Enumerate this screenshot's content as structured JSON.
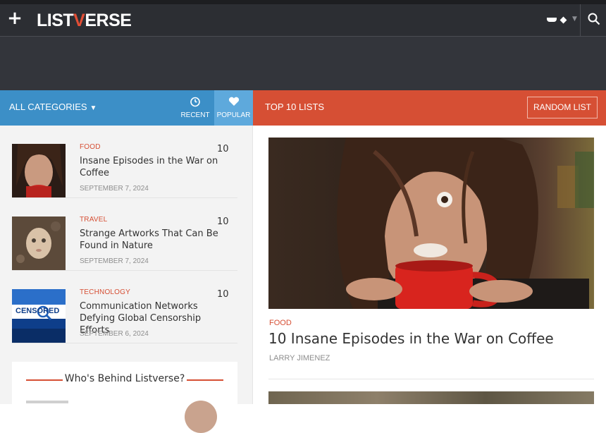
{
  "header": {
    "logo_left": "LIST",
    "logo_v": "V",
    "logo_right": "ERSE",
    "plus_icon": "plus-icon",
    "search_icon": "search-icon"
  },
  "category_bar": {
    "all_categories_label": "ALL CATEGORIES",
    "recent_label": "RECENT",
    "popular_label": "POPULAR"
  },
  "top_bar": {
    "title": "TOP 10 LISTS",
    "random_label": "RANDOM LIST"
  },
  "sidebar": {
    "items": [
      {
        "category": "FOOD",
        "title": "Insane Episodes in the War on Coffee",
        "date": "SEPTEMBER 7, 2024",
        "number": "10"
      },
      {
        "category": "TRAVEL",
        "title": "Strange Artworks That Can Be Found in Nature",
        "date": "SEPTEMBER 7, 2024",
        "number": "10"
      },
      {
        "category": "TECHNOLOGY",
        "title": "Communication Networks Defying Global Censorship Efforts",
        "date": "SEPTEMBER 6, 2024",
        "number": "10"
      }
    ],
    "censored_text": "CENSORED",
    "who_title": "Who's Behind Listverse?"
  },
  "featured": {
    "category": "FOOD",
    "title": "10 Insane Episodes in the War on Coffee",
    "author": "LARRY JIMENEZ"
  },
  "colors": {
    "header_bg": "#2c2e33",
    "blue_accent": "#3c8fc7",
    "red_accent": "#d64f34"
  }
}
